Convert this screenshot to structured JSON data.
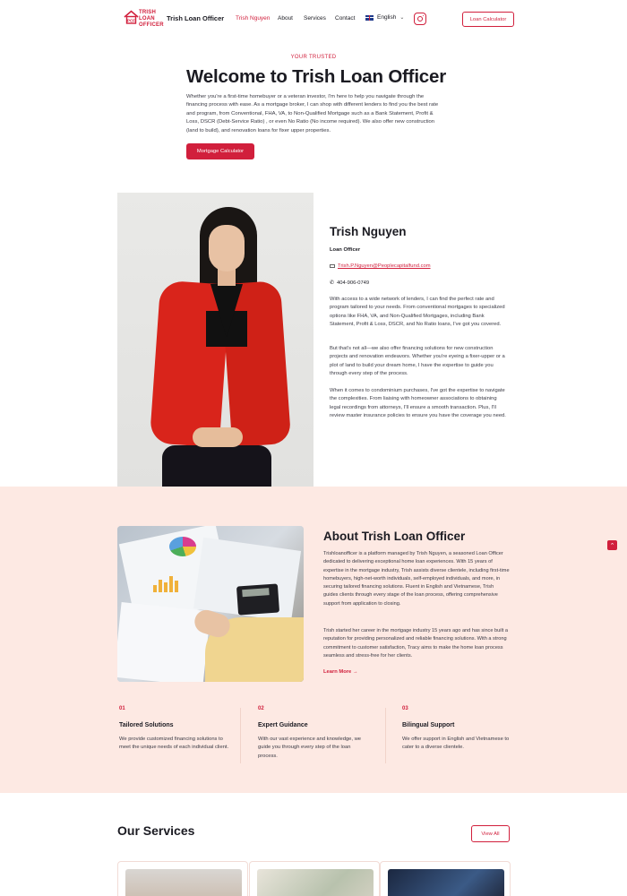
{
  "nav": {
    "logo_text": [
      "TRISH",
      "LOAN",
      "OFFICER"
    ],
    "brand": "Trish Loan Officer",
    "links": [
      "Trish Nguyen",
      "About",
      "Services",
      "Contact"
    ],
    "language": "English",
    "cta": "Loan Calculator"
  },
  "hero": {
    "eyebrow": "YOUR TRUSTED",
    "title": "Welcome to Trish Loan Officer",
    "text": "Whether you're a first-time homebuyer or a veteran investor, I'm here to help you navigate through the financing process with ease. As a mortgage broker, I can shop with different lenders to find you the best rate and program, from Conventional, FHA, VA, to Non-Qualified Mortgage such as a Bank Statement, Profit & Loss, DSCR (Debt-Service Ratio) , or even No Ratio (No income required). We also offer new construction (land to build), and renovation loans for fixer upper properties.",
    "button": "Mortgage Calculator"
  },
  "profile": {
    "name": "Trish Nguyen",
    "role": "Loan Officer",
    "email": "Trish.P.Nguyen@Peoplecapitalfund.com",
    "phone": "404-906-0749",
    "bio": [
      "With access to a wide network of lenders, I can find the perfect rate and program tailored to your needs. From conventional mortgages to specialized options like FHA, VA, and Non-Qualified Mortgages, including Bank Statement, Profit & Loss, DSCR, and No Ratio loans, I've got you covered.",
      "But that's not all—we also offer financing solutions for new construction projects and renovation endeavors. Whether you're eyeing a fixer-upper or a plot of land to build your dream home, I have the expertise to guide you through every step of the process.",
      "When it comes to condominium purchases, I've got the expertise to navigate the complexities. From liaising with homeowner associations to obtaining legal recordings from attorneys, I'll ensure a smooth transaction. Plus, I'll review master insurance policies to ensure you have the coverage you need."
    ]
  },
  "about": {
    "title": "About Trish Loan Officer",
    "paragraphs": [
      "Trishloanofficer is a platform managed by Trish Nguyen, a seasoned Loan Officer dedicated to delivering exceptional home loan experiences. With 15 years of expertise in the mortgage industry, Trish assists diverse clientele, including first-time homebuyers, high-net-worth individuals, self-employed individuals, and more, in securing tailored financing solutions. Fluent in English and Vietnamese, Trish guides clients through every stage of the loan process, offering comprehensive support from application to closing.",
      "Trish started her career in the mortgage industry 15 years ago and has since built a reputation for providing personalized and reliable financing solutions. With a strong commitment to customer satisfaction, Tracy aims to make the home loan process seamless and stress-free for her clients."
    ],
    "learn_more": "Learn More →",
    "features": [
      {
        "num": "01",
        "title": "Tailored Solutions",
        "text": "We provide customized financing solutions to meet the unique needs of each individual client."
      },
      {
        "num": "02",
        "title": "Expert Guidance",
        "text": "With our vast experience and knowledge, we guide you through every step of the loan process."
      },
      {
        "num": "03",
        "title": "Bilingual Support",
        "text": "We offer support in English and Vietnamese to cater to a diverse clientele."
      }
    ]
  },
  "services": {
    "title": "Our Services",
    "button": "View All"
  },
  "colors": {
    "accent": "#d11f3c",
    "about_bg": "#fde9e3"
  },
  "icons": [
    "house-logo-icon",
    "flag-uk-icon",
    "chevron-down-icon",
    "instagram-icon",
    "mail-icon",
    "phone-icon",
    "arrow-right-icon",
    "arrow-up-icon"
  ]
}
